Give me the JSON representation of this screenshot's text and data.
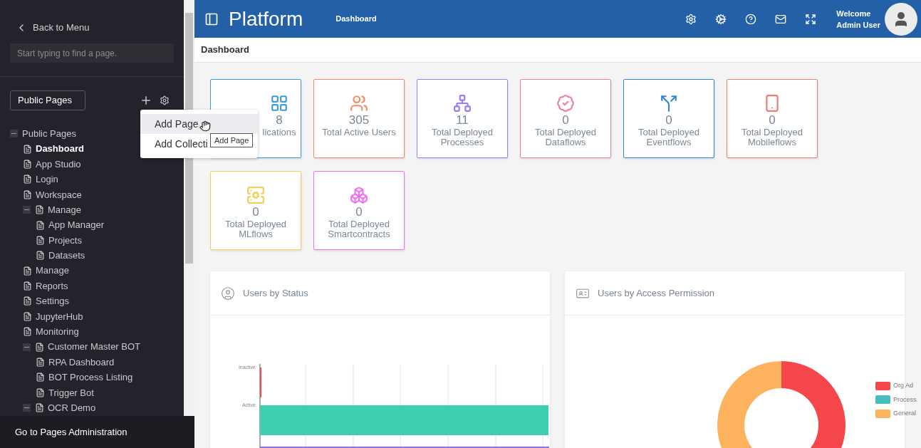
{
  "sidebar": {
    "back_link": "Back to Menu",
    "search": {
      "placeholder": "Start typing to find a page."
    },
    "collection_select": "Public Pages",
    "tree": [
      {
        "label": "Public Pages",
        "selected": false,
        "expanded": true,
        "children": [
          {
            "label": "Dashboard",
            "selected": true
          },
          {
            "label": "App Studio",
            "selected": false
          },
          {
            "label": "Login",
            "selected": false
          },
          {
            "label": "Workspace",
            "selected": false
          },
          {
            "label": "Manage",
            "selected": false,
            "expanded": true,
            "children": [
              {
                "label": "App Manager",
                "selected": false
              },
              {
                "label": "Projects",
                "selected": false
              },
              {
                "label": "Datasets",
                "selected": false
              }
            ]
          },
          {
            "label": "Manage",
            "selected": false
          },
          {
            "label": "Reports",
            "selected": false
          },
          {
            "label": "Settings",
            "selected": false
          },
          {
            "label": "JupyterHub",
            "selected": false
          },
          {
            "label": "Monitoring",
            "selected": false
          },
          {
            "label": "Customer Master BOT",
            "selected": false,
            "expanded": true,
            "children": [
              {
                "label": "RPA Dashboard",
                "selected": false
              },
              {
                "label": "BOT Process Listing",
                "selected": false
              },
              {
                "label": "Trigger Bot",
                "selected": false
              }
            ]
          },
          {
            "label": "OCR Demo",
            "selected": false,
            "expanded": true
          }
        ]
      }
    ],
    "footer_link": "Go to Pages Administration"
  },
  "add_menu": {
    "items": [
      {
        "label": "Add Page",
        "highlighted": true
      },
      {
        "label": "Add Collecti",
        "highlighted": false
      }
    ],
    "tooltip": "Add Page"
  },
  "header": {
    "brand": "Platform",
    "page_title": "Dashboard",
    "welcome": "Welcome",
    "user": "Admin User"
  },
  "breadcrumb": "Dashboard",
  "stats": [
    {
      "value": "8",
      "label": "lications",
      "color": "#3c9ad8"
    },
    {
      "value": "305",
      "label": "Total Active Users",
      "color": "#f58a68"
    },
    {
      "value": "11",
      "label": "Total Deployed Processes",
      "color": "#9b7cf6"
    },
    {
      "value": "0",
      "label": "Total Deployed Dataflows",
      "color": "#ee7ea6"
    },
    {
      "value": "0",
      "label": "Total Deployed Eventflows",
      "color": "#2f86d6"
    },
    {
      "value": "0",
      "label": "Total Deployed Mobileflows",
      "color": "#ef7b7b"
    },
    {
      "value": "0",
      "label": "Total Deployed MLflows",
      "color": "#f5cd5c"
    },
    {
      "value": "0",
      "label": "Total Deployed Smartcontracts",
      "color": "#ee72ee"
    }
  ],
  "charts": [
    {
      "title": "Users by Status",
      "categories": [
        {
          "label": "Inactive",
          "color": "#f54b50"
        },
        {
          "label": "Active",
          "color": "#3ecfb2"
        }
      ]
    },
    {
      "title": "Users by Access Permission",
      "legend": [
        {
          "label": "Org Ad",
          "color": "#f5464b"
        },
        {
          "label": "Process",
          "color": "#45bfbd"
        },
        {
          "label": "General",
          "color": "#fdb35e"
        }
      ]
    }
  ]
}
